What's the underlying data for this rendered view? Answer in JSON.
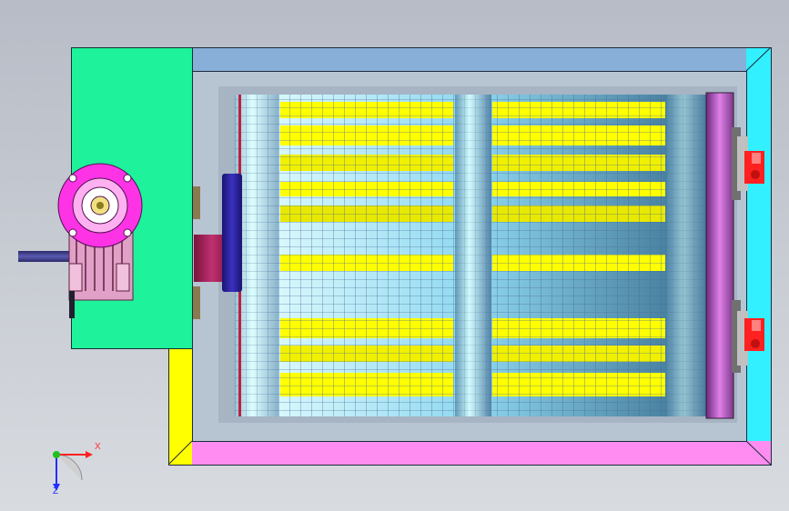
{
  "viewport": {
    "axis_labels": {
      "x": "X",
      "z": "Z"
    }
  },
  "colors": {
    "background": "#c0c4cc",
    "frame_top": "#87afd7",
    "frame_right": "#32f0ff",
    "frame_bottom": "#ff8cf0",
    "frame_left": "#ffff00",
    "motor_plate": "#1ef29a",
    "motor_flange": "#ff33e6",
    "gearbox": "#e8a0c8",
    "drum_mesh": "#9fe8ff",
    "drum_slats": "#ffff00",
    "end_disc": "#b048c0",
    "bearing": "#ff2020"
  },
  "icons": {
    "axis_triad": "axis-triad-icon",
    "motor": "motor-icon",
    "bearing": "bearing-icon"
  }
}
